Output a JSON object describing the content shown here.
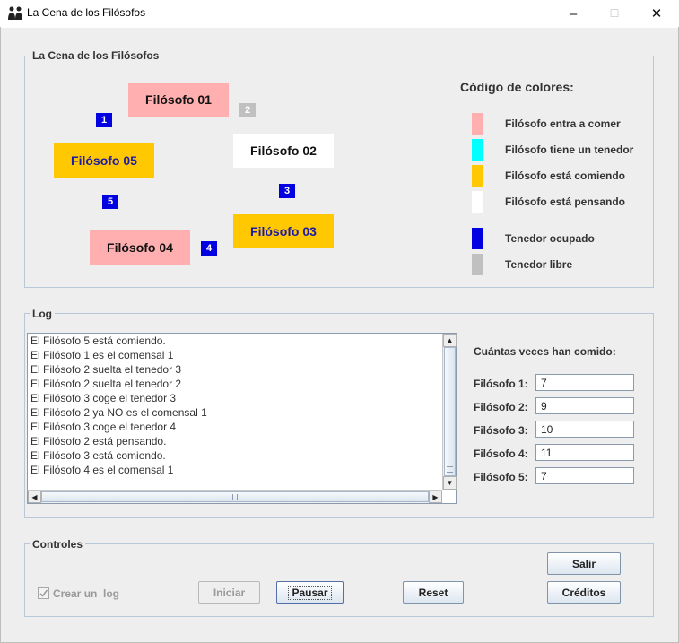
{
  "window": {
    "title": "La Cena de los Filósofos",
    "minimize_glyph": "–",
    "maximize_glyph": "☐",
    "close_glyph": "✕"
  },
  "table_panel": {
    "title": "La Cena de los Filósofos",
    "philosophers": [
      {
        "label": "Filósofo 01",
        "state": "entra a comer",
        "color": "#ffafaf"
      },
      {
        "label": "Filósofo 02",
        "state": "pensando",
        "color": "#ffffff"
      },
      {
        "label": "Filósofo 03",
        "state": "comiendo",
        "color": "#ffc800"
      },
      {
        "label": "Filósofo 04",
        "state": "entra a comer",
        "color": "#ffafaf"
      },
      {
        "label": "Filósofo 05",
        "state": "comiendo",
        "color": "#ffc800"
      }
    ],
    "forks": [
      {
        "label": "1",
        "state": "ocupado",
        "color": "#0000e0"
      },
      {
        "label": "2",
        "state": "libre",
        "color": "#c0c0c0"
      },
      {
        "label": "3",
        "state": "ocupado",
        "color": "#0000e0"
      },
      {
        "label": "4",
        "state": "ocupado",
        "color": "#0000e0"
      },
      {
        "label": "5",
        "state": "ocupado",
        "color": "#0000e0"
      }
    ],
    "legend": {
      "title": "Código de colores:",
      "items": [
        {
          "label": "Filósofo entra a comer",
          "color": "#ffafaf"
        },
        {
          "label": "Filósofo tiene un tenedor",
          "color": "#00ffff"
        },
        {
          "label": "Filósofo está comiendo",
          "color": "#ffc800"
        },
        {
          "label": "Filósofo está pensando",
          "color": "#ffffff"
        },
        {
          "label": "Tenedor ocupado",
          "color": "#0000e0"
        },
        {
          "label": "Tenedor libre",
          "color": "#c0c0c0"
        }
      ]
    }
  },
  "log_panel": {
    "title": "Log",
    "lines": [
      "El Filósofo 5 está comiendo.",
      "El Filósofo 1 es el comensal 1",
      "El Filósofo 2 suelta el tenedor 3",
      "El Filósofo 2 suelta el tenedor 2",
      "El Filósofo 3 coge el tenedor 3",
      "El Filósofo 2 ya NO es el comensal 1",
      "El Filósofo 3 coge el tenedor 4",
      "El Filósofo 2 está pensando.",
      "El Filósofo 3 está comiendo.",
      "El Filósofo 4 es el comensal 1"
    ],
    "counts_title": "Cuántas veces han comido:",
    "counts": [
      {
        "label": "Filósofo 1:",
        "value": "7"
      },
      {
        "label": "Filósofo 2:",
        "value": "9"
      },
      {
        "label": "Filósofo 3:",
        "value": "10"
      },
      {
        "label": "Filósofo 4:",
        "value": "11"
      },
      {
        "label": "Filósofo 5:",
        "value": "7"
      }
    ]
  },
  "controls_panel": {
    "title": "Controles",
    "create_log_label": "Crear un  log",
    "create_log_checked": true,
    "iniciar": "Iniciar",
    "pausar": "Pausar",
    "reset": "Reset",
    "salir": "Salir",
    "creditos": "Créditos"
  }
}
